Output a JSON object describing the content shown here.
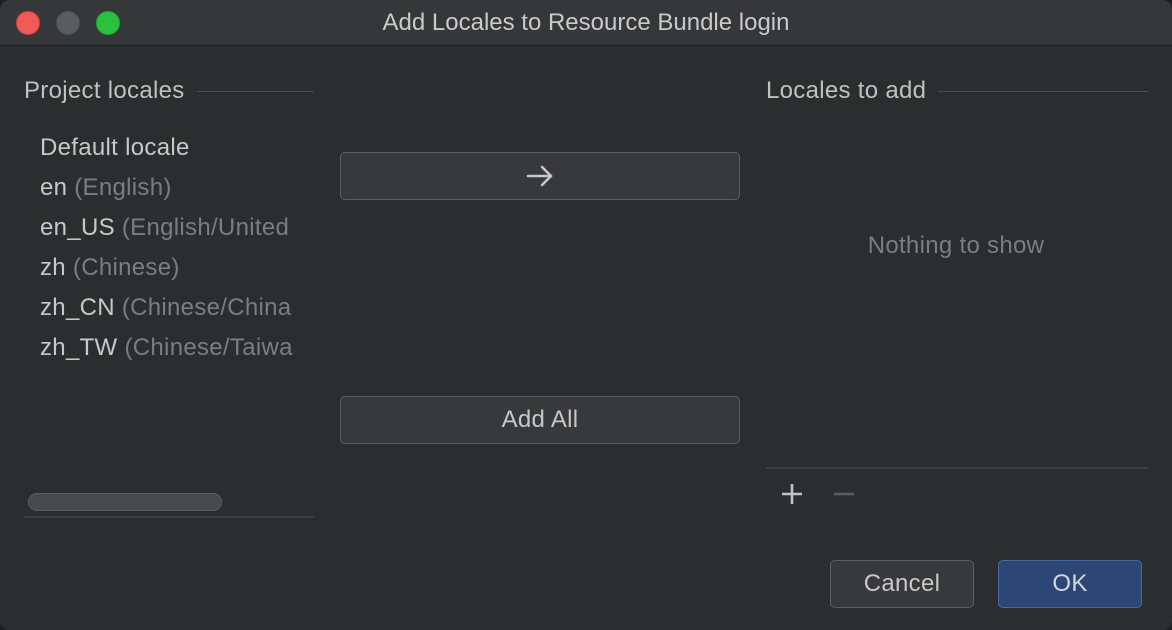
{
  "window": {
    "title": "Add Locales to Resource Bundle login"
  },
  "project_locales": {
    "header": "Project locales",
    "items": [
      {
        "code": "Default locale",
        "desc": ""
      },
      {
        "code": "en",
        "desc": "(English)"
      },
      {
        "code": "en_US",
        "desc": "(English/United"
      },
      {
        "code": "zh",
        "desc": "(Chinese)"
      },
      {
        "code": "zh_CN",
        "desc": "(Chinese/China"
      },
      {
        "code": "zh_TW",
        "desc": "(Chinese/Taiwa"
      }
    ]
  },
  "middle": {
    "move_icon": "arrow-right-icon",
    "add_all_label": "Add All"
  },
  "locales_to_add": {
    "header": "Locales to add",
    "empty_text": "Nothing to show",
    "add_icon": "plus-icon",
    "remove_icon": "minus-icon"
  },
  "footer": {
    "cancel_label": "Cancel",
    "ok_label": "OK"
  },
  "colors": {
    "background": "#2b2e2f",
    "primary_button": "#2e4675",
    "close": "#ee5b58",
    "zoom": "#29c13f"
  }
}
